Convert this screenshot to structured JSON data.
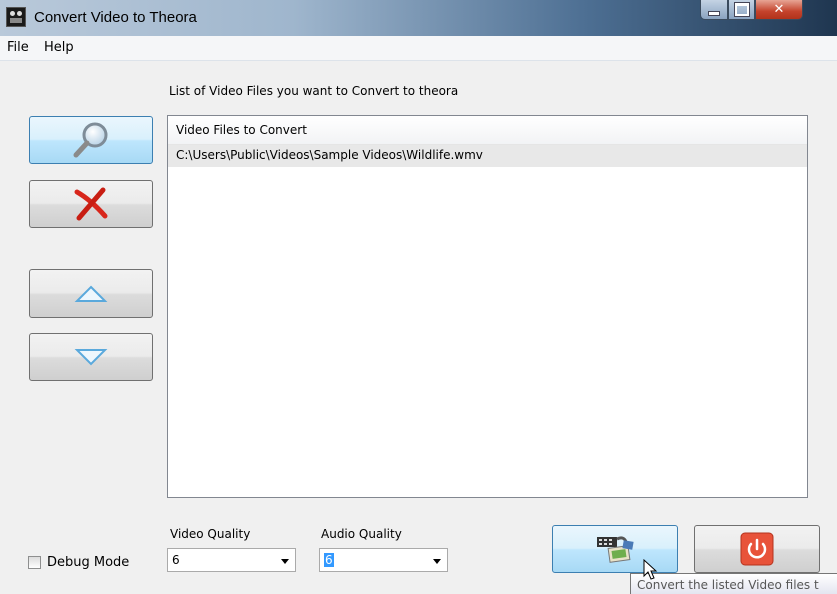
{
  "window": {
    "title": "Convert Video to Theora"
  },
  "menu": {
    "items": [
      "File",
      "Help"
    ]
  },
  "left_tools": [
    {
      "name": "browse-button",
      "icon": "magnifier-icon"
    },
    {
      "name": "remove-button",
      "icon": "red-x-icon"
    },
    {
      "name": "move-up-button",
      "icon": "triangle-up-icon"
    },
    {
      "name": "move-down-button",
      "icon": "triangle-down-icon"
    }
  ],
  "list": {
    "label": "List of Video Files you want to Convert to theora",
    "column_header": "Video Files to Convert",
    "rows": [
      "C:\\Users\\Public\\Videos\\Sample Videos\\Wildlife.wmv"
    ]
  },
  "video_quality": {
    "label": "Video Quality",
    "value": "6"
  },
  "audio_quality": {
    "label": "Audio Quality",
    "value": "6"
  },
  "debug_mode": {
    "label": "Debug Mode",
    "checked": false
  },
  "actions": {
    "convert_icon": "film-convert-icon",
    "exit_icon": "power-icon"
  },
  "tooltip": {
    "text": "Convert the listed Video files t"
  },
  "colors": {
    "accent": "#3c7fb1",
    "close_red": "#c4432c",
    "power_red": "#e8533a"
  }
}
